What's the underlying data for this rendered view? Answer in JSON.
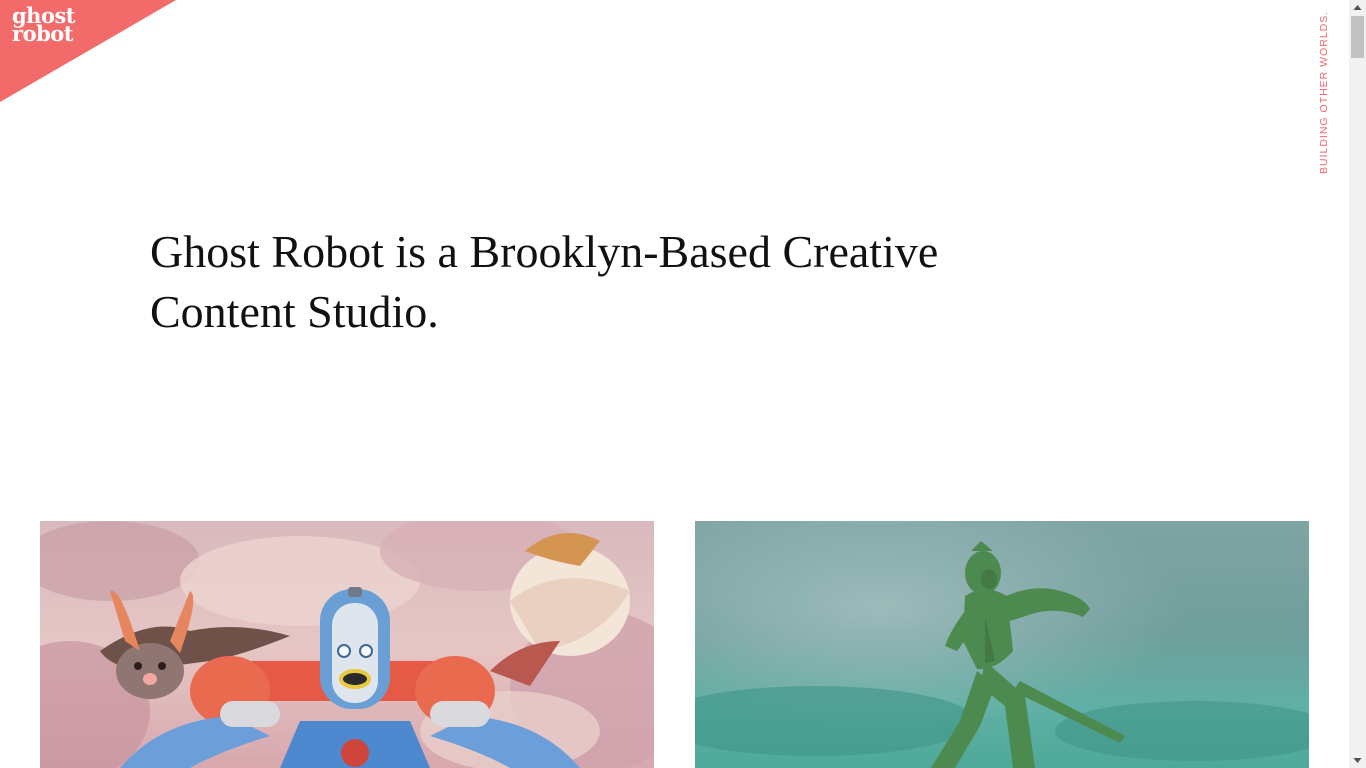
{
  "logo": {
    "line1": "ghost",
    "line2": "robot",
    "color": "#f0676a",
    "icon": "ghost-robot-logo"
  },
  "tagline": "BUILDING OTHER WORLDS.",
  "headline": "Ghost Robot is a Brooklyn-Based Creative Content Studio.",
  "projects": [
    {
      "name": "animated-robot-and-creatures-in-clouds"
    },
    {
      "name": "green-toy-soldier-figure"
    }
  ],
  "colors": {
    "accent": "#f0676a",
    "text": "#111111",
    "background": "#ffffff"
  }
}
